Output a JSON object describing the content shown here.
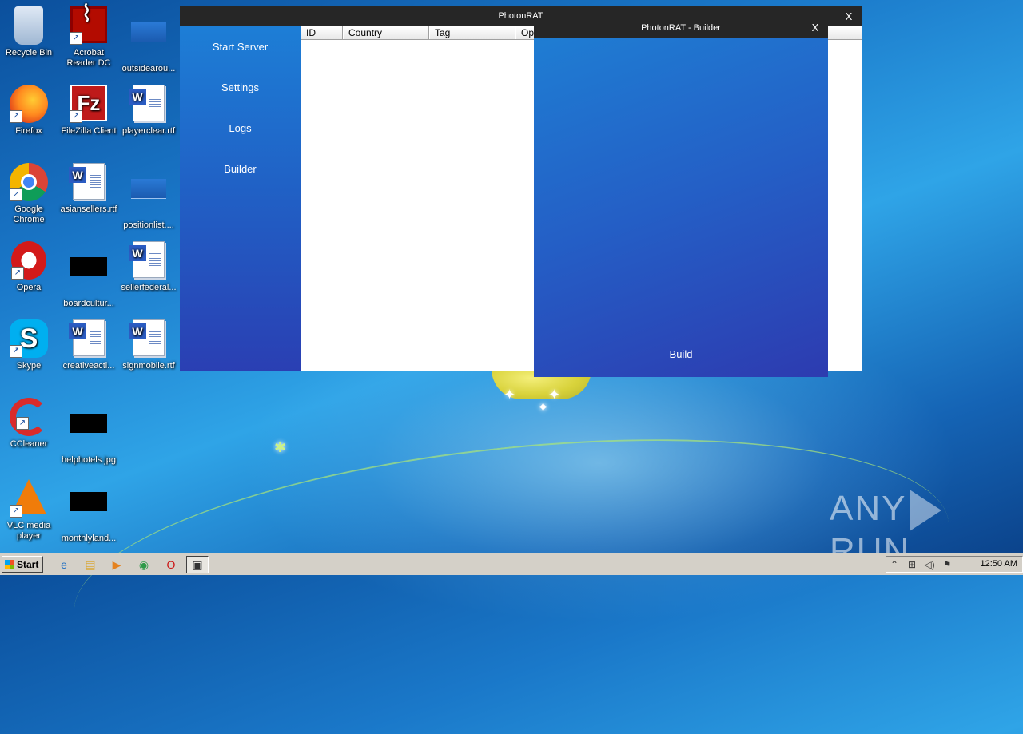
{
  "desktop": {
    "icons": [
      {
        "label": "Recycle Bin",
        "icon": "recycle-bin-icon"
      },
      {
        "label": "Acrobat Reader DC",
        "icon": "acrobat-icon"
      },
      {
        "label": "outsidearou...",
        "icon": "file-icon"
      },
      {
        "label": "Firefox",
        "icon": "firefox-icon"
      },
      {
        "label": "FileZilla Client",
        "icon": "filezilla-icon"
      },
      {
        "label": "playerclear.rtf",
        "icon": "word-doc-icon"
      },
      {
        "label": "Google Chrome",
        "icon": "chrome-icon"
      },
      {
        "label": "asiansellers.rtf",
        "icon": "word-doc-icon"
      },
      {
        "label": "positionlist....",
        "icon": "file-icon"
      },
      {
        "label": "Opera",
        "icon": "opera-icon"
      },
      {
        "label": "boardcultur...",
        "icon": "image-icon"
      },
      {
        "label": "sellerfederal...",
        "icon": "word-doc-icon"
      },
      {
        "label": "Skype",
        "icon": "skype-icon"
      },
      {
        "label": "creativeacti...",
        "icon": "word-doc-icon"
      },
      {
        "label": "signmobile.rtf",
        "icon": "word-doc-icon"
      },
      {
        "label": "CCleaner",
        "icon": "ccleaner-icon"
      },
      {
        "label": "helphotels.jpg",
        "icon": "image-icon"
      },
      {
        "label": "VLC media player",
        "icon": "vlc-icon"
      },
      {
        "label": "monthlyland...",
        "icon": "image-icon"
      }
    ]
  },
  "main_window": {
    "title": "PhotonRAT",
    "close_label": "X",
    "sidebar": [
      {
        "label": "Start Server"
      },
      {
        "label": "Settings"
      },
      {
        "label": "Logs"
      },
      {
        "label": "Builder"
      }
    ],
    "columns": [
      "ID",
      "Country",
      "Tag",
      "Ope"
    ]
  },
  "builder_window": {
    "title": "PhotonRAT - Builder",
    "close_label": "X",
    "build_label": "Build"
  },
  "watermark": {
    "left": "ANY",
    "right": "RUN"
  },
  "taskbar": {
    "start_label": "Start",
    "clock": "12:50 AM"
  }
}
